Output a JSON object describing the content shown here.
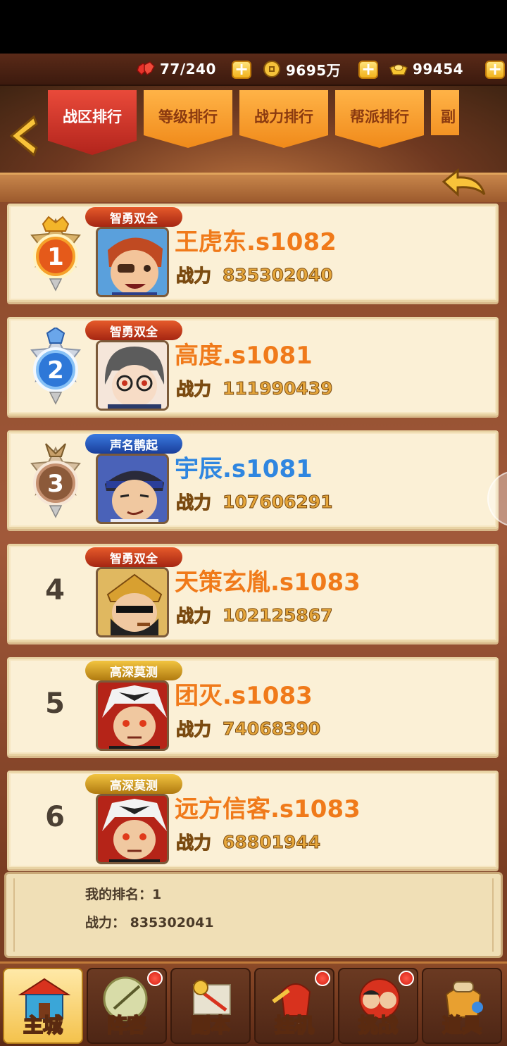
{
  "resources": {
    "stamina": "77/240",
    "coins": "9695万",
    "ingots": "99454"
  },
  "tabs": [
    {
      "label": "战区排行",
      "active": true
    },
    {
      "label": "等级排行",
      "active": false
    },
    {
      "label": "战力排行",
      "active": false
    },
    {
      "label": "帮派排行",
      "active": false
    },
    {
      "label": "副",
      "active": false
    }
  ],
  "ranking": [
    {
      "rank": "1",
      "title": "智勇双全",
      "name": "王虎东.s1082",
      "power_label": "战力",
      "power": "835302040",
      "name_color": "#f07a1a",
      "title_color": "#d8431e"
    },
    {
      "rank": "2",
      "title": "智勇双全",
      "name": "高度.s1081",
      "power_label": "战力",
      "power": "111990439",
      "name_color": "#f07a1a",
      "title_color": "#d8431e"
    },
    {
      "rank": "3",
      "title": "声名鹊起",
      "name": "宇辰.s1081",
      "power_label": "战力",
      "power": "107606291",
      "name_color": "#2f86e0",
      "title_color": "#2a5db8"
    },
    {
      "rank": "4",
      "title": "智勇双全",
      "name": "天策玄胤.s1083",
      "power_label": "战力",
      "power": "102125867",
      "name_color": "#f07a1a",
      "title_color": "#d8431e"
    },
    {
      "rank": "5",
      "title": "高深莫测",
      "name": "团灭.s1083",
      "power_label": "战力",
      "power": "74068390",
      "name_color": "#f07a1a",
      "title_color": "#e0a21c"
    },
    {
      "rank": "6",
      "title": "高深莫测",
      "name": "远方信客.s1083",
      "power_label": "战力",
      "power": "68801944",
      "name_color": "#f07a1a",
      "title_color": "#e0a21c"
    }
  ],
  "my_rank": {
    "rank_text": "我的排名：1",
    "power_text": "战力：  835302041"
  },
  "nav": [
    {
      "label": "主城",
      "active": true,
      "dot": false,
      "icon": "castle-icon"
    },
    {
      "label": "阵容",
      "active": false,
      "dot": true,
      "icon": "formation-icon"
    },
    {
      "label": "副本",
      "active": false,
      "dot": false,
      "icon": "dungeon-icon"
    },
    {
      "label": "挂机",
      "active": false,
      "dot": true,
      "icon": "idle-icon"
    },
    {
      "label": "挑战",
      "active": false,
      "dot": true,
      "icon": "challenge-icon"
    },
    {
      "label": "道具",
      "active": false,
      "dot": false,
      "icon": "items-icon"
    }
  ],
  "colors": {
    "accent_orange": "#f07a1a",
    "panel": "#fbf0d6",
    "tab_active": "#c4291f",
    "tab_inactive": "#f59a2a"
  }
}
